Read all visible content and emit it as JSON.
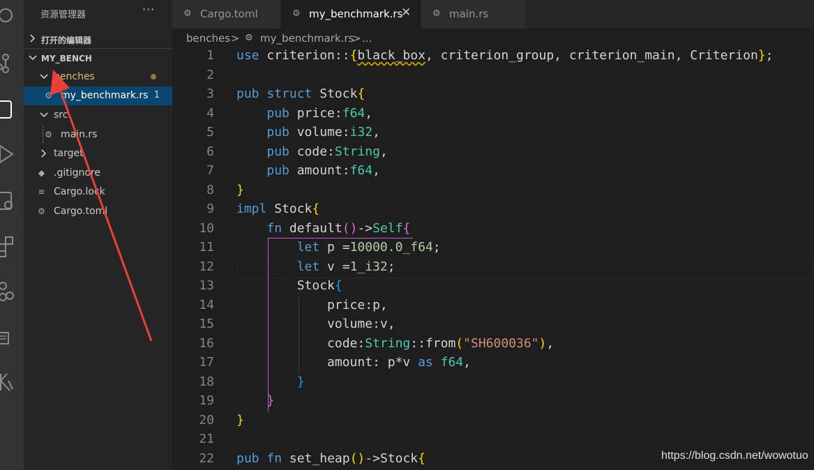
{
  "explorer": {
    "title": "资源管理器",
    "more": "···",
    "open_editors": "打开的编辑器",
    "project": "MY_BENCH",
    "tree": [
      {
        "label": "benches",
        "kind": "folder"
      },
      {
        "label": "my_benchmark.rs",
        "kind": "rust",
        "badge": "1"
      },
      {
        "label": "src",
        "kind": "folder"
      },
      {
        "label": "main.rs",
        "kind": "rust"
      },
      {
        "label": "target",
        "kind": "folder"
      },
      {
        "label": ".gitignore",
        "kind": "git"
      },
      {
        "label": "Cargo.lock",
        "kind": "lock"
      },
      {
        "label": "Cargo.toml",
        "kind": "toml"
      }
    ]
  },
  "tabs": [
    {
      "label": "Cargo.toml",
      "icon": "gear-icon"
    },
    {
      "label": "my_benchmark.rs",
      "icon": "rust-icon",
      "active": true,
      "close": "✕"
    },
    {
      "label": "main.rs",
      "icon": "rust-icon"
    }
  ],
  "breadcrumb": {
    "part1": "benches",
    "sep": ">",
    "part2": "my_benchmark.rs",
    "part3": "..."
  },
  "editor": {
    "line_numbers": [
      "1",
      "2",
      "3",
      "4",
      "5",
      "6",
      "7",
      "8",
      "9",
      "10",
      "11",
      "12",
      "13",
      "14",
      "15",
      "16",
      "17",
      "18",
      "19",
      "20",
      "21",
      "22"
    ],
    "lines": [
      "use criterion::{black_box, criterion_group, criterion_main, Criterion};",
      "",
      "pub struct Stock{",
      "    pub price:f64,",
      "    pub volume:i32,",
      "    pub code:String,",
      "    pub amount:f64,",
      "}",
      "impl Stock{",
      "    fn default()->Self{",
      "        let p =10000.0_f64;",
      "        let v =1_i32;",
      "        Stock{",
      "            price:p,",
      "            volume:v,",
      "            code:String::from(\"SH600036\"),",
      "            amount: p*v as f64,",
      "        }",
      "    }",
      "}",
      "",
      "pub fn set_heap()->Stock{"
    ]
  },
  "watermark": "https://blog.csdn.net/wowotuo",
  "colors": {
    "accent": "#094771",
    "annotation_arrow": "#e8403a",
    "folder_modified": "#d7ba7d"
  }
}
